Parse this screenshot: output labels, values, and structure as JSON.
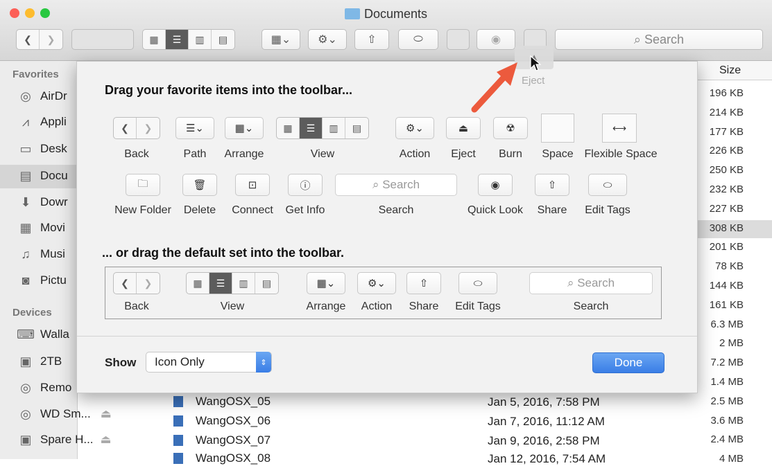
{
  "window": {
    "title": "Documents"
  },
  "toolbar": {
    "search_placeholder": "Search"
  },
  "eject_drag": {
    "label": "Eject"
  },
  "sidebar": {
    "favorites_header": "Favorites",
    "favorites": [
      "AirDr",
      "Appli",
      "Desk",
      "Docu",
      "Dowr",
      "Movi",
      "Musi",
      "Pictu"
    ],
    "devices_header": "Devices",
    "devices": [
      "Walla",
      "2TB",
      "Remo",
      "WD Sm...",
      "Spare H..."
    ]
  },
  "list": {
    "size_header": "Size",
    "sizes": [
      "196 KB",
      "214 KB",
      "177 KB",
      "226 KB",
      "250 KB",
      "232 KB",
      "227 KB",
      "308 KB",
      "201 KB",
      "78 KB",
      "144 KB",
      "161 KB",
      "6.3 MB",
      "2 MB",
      "7.2 MB",
      "1.4 MB",
      "2.5 MB",
      "3.6 MB",
      "2.4 MB",
      "4 MB"
    ],
    "files": [
      {
        "name": "WangOSX_05",
        "date": "Jan 5, 2016, 7:58 PM"
      },
      {
        "name": "WangOSX_06",
        "date": "Jan 7, 2016, 11:12 AM"
      },
      {
        "name": "WangOSX_07",
        "date": "Jan 9, 2016, 2:58 PM"
      },
      {
        "name": "WangOSX_08",
        "date": "Jan 12, 2016, 7:54 AM"
      }
    ]
  },
  "sheet": {
    "heading1": "Drag your favorite items into the toolbar...",
    "heading2": "... or drag the default set into the toolbar.",
    "items_row1": {
      "back": "Back",
      "path": "Path",
      "arrange": "Arrange",
      "view": "View",
      "action": "Action",
      "eject": "Eject",
      "burn": "Burn",
      "space": "Space",
      "flexible_space": "Flexible Space"
    },
    "items_row2": {
      "new_folder": "New Folder",
      "delete": "Delete",
      "connect": "Connect",
      "get_info": "Get Info",
      "search": "Search",
      "quick_look": "Quick Look",
      "share": "Share",
      "edit_tags": "Edit Tags"
    },
    "search_placeholder": "Search",
    "default_set": {
      "back": "Back",
      "view": "View",
      "arrange": "Arrange",
      "action": "Action",
      "share": "Share",
      "edit_tags": "Edit Tags",
      "search": "Search"
    },
    "show_label": "Show",
    "show_value": "Icon Only",
    "done": "Done"
  }
}
